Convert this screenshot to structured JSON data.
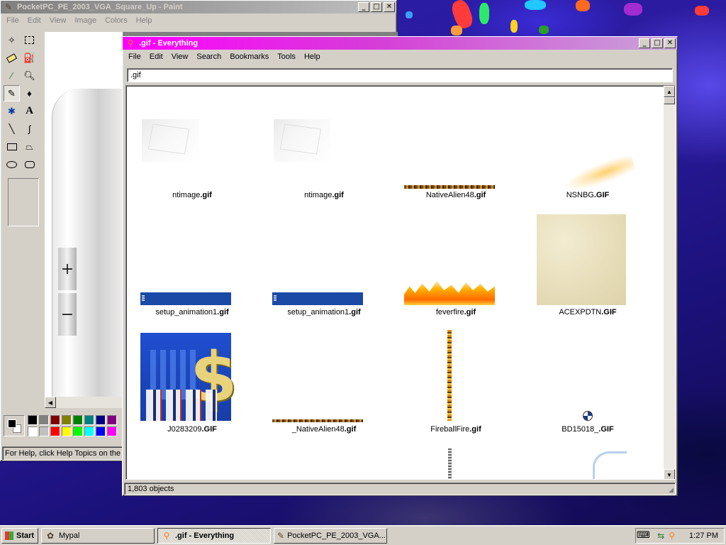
{
  "paint": {
    "title": "PocketPC_PE_2003_VGA_Square_Up - Paint",
    "menu": [
      "File",
      "Edit",
      "View",
      "Image",
      "Colors",
      "Help"
    ],
    "status": "For Help, click Help Topics on the Help Menu.",
    "zoom_in_symbol": "+",
    "zoom_out_symbol": "−",
    "tool_letter": "A",
    "palette_top": [
      "#000000",
      "#808080",
      "#800000",
      "#808000",
      "#008000",
      "#008080",
      "#000080",
      "#800080"
    ],
    "palette_bottom": [
      "#ffffff",
      "#c0c0c0",
      "#ff0000",
      "#ffff00",
      "#00ff00",
      "#00ffff",
      "#0000ff",
      "#ff00ff"
    ]
  },
  "everything": {
    "title": ".gif - Everything",
    "menu": [
      "File",
      "Edit",
      "View",
      "Search",
      "Bookmarks",
      "Tools",
      "Help"
    ],
    "search_value": ".gif",
    "status": "1,803 objects",
    "results": [
      {
        "name": "ntimage",
        "ext": ".gif"
      },
      {
        "name": "ntimage",
        "ext": ".gif"
      },
      {
        "name": "NativeAlien48",
        "ext": ".gif"
      },
      {
        "name": "NSNBG",
        "ext": ".GIF"
      },
      {
        "name": "setup_animation1",
        "ext": ".gif"
      },
      {
        "name": "setup_animation1",
        "ext": ".gif"
      },
      {
        "name": "feverfire",
        "ext": ".gif"
      },
      {
        "name": "ACEXPDTN",
        "ext": ".GIF"
      },
      {
        "name": "J0283209",
        "ext": ".GIF"
      },
      {
        "name": "_NativeAlien48",
        "ext": ".gif"
      },
      {
        "name": "FireballFire",
        "ext": ".gif"
      },
      {
        "name": "BD15018_",
        "ext": ".GIF"
      }
    ]
  },
  "taskbar": {
    "start": "Start",
    "buttons": [
      "Mypal",
      ".gif - Everything",
      "PocketPC_PE_2003_VGA..."
    ],
    "clock": "1:27 PM"
  },
  "icons": {
    "minimize": "minimize-icon",
    "maximize": "maximize-icon",
    "close": "close-icon",
    "search": "magnifier-icon"
  },
  "colors": {
    "everything_title": "#ff00ff",
    "paint_title_inactive": "#808080",
    "desktop": "#2a1ca8"
  }
}
